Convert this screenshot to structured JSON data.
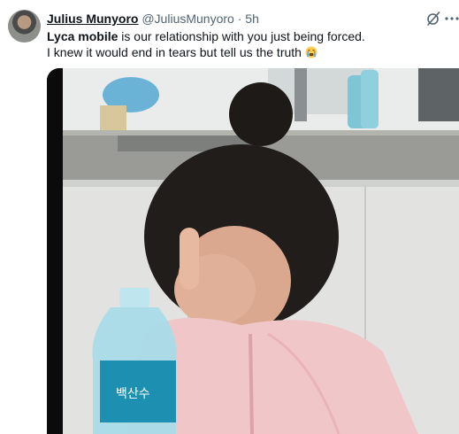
{
  "tweet": {
    "author_name": "Julius Munyoro",
    "handle": "@JuliusMunyoro",
    "separator": "·",
    "time": "5h",
    "text_bold": "Lyca mobile",
    "text_line1_rest": " is our relationship with you just being forced.",
    "text_line2": "I knew it would end in tears but tell us the truth",
    "emoji": "loudly-crying-face",
    "media_alt": "child covering face with hand next to a water bottle",
    "bottle_label": "백산수"
  },
  "icons": {
    "grok": "grok-icon",
    "more": "more-icon"
  },
  "colors": {
    "secondary_text": "#536471",
    "primary_text": "#0f1419"
  }
}
